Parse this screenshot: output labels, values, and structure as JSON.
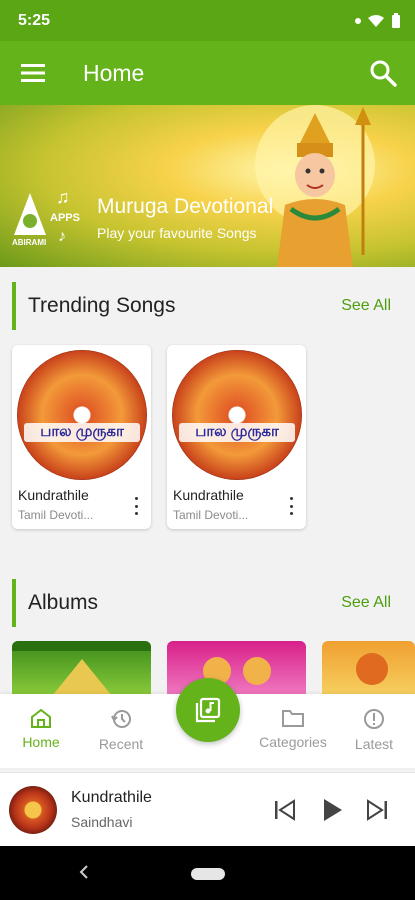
{
  "status_bar": {
    "time": "5:25"
  },
  "app_bar": {
    "title": "Home"
  },
  "banner": {
    "logo_text": "ABIRAMI",
    "logo_apps": "APPS",
    "title": "Muruga Devotional",
    "subtitle": "Play your favourite Songs"
  },
  "trending": {
    "title": "Trending Songs",
    "see_all": "See All",
    "items": [
      {
        "cover_text": "பால முருகா",
        "title": "Kundrathile",
        "subtitle": "Tamil Devoti..."
      },
      {
        "cover_text": "பால முருகா",
        "title": "Kundrathile",
        "subtitle": "Tamil Devoti..."
      }
    ]
  },
  "albums": {
    "title": "Albums",
    "see_all": "See All"
  },
  "bottom_nav": {
    "items": [
      {
        "label": "Home",
        "icon": "home-icon"
      },
      {
        "label": "Recent",
        "icon": "history-icon"
      },
      {
        "label": "Categories",
        "icon": "folder-icon"
      },
      {
        "label": "Latest",
        "icon": "alert-icon"
      }
    ],
    "fab_icon": "library-music-icon"
  },
  "player": {
    "title": "Kundrathile",
    "artist": "Saindhavi"
  },
  "colors": {
    "primary": "#64b31b",
    "status": "#5ba614"
  }
}
